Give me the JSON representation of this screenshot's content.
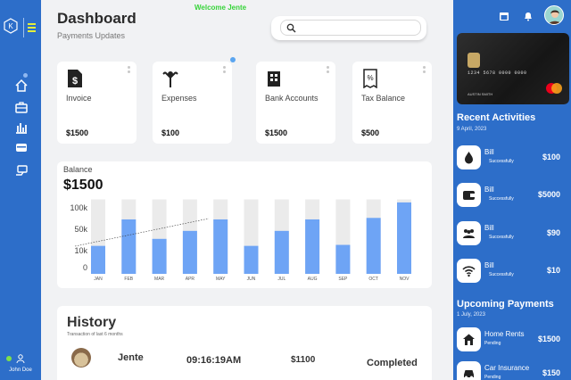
{
  "header": {
    "title": "Dashboard",
    "subtitle": "Payments Updates",
    "welcome": "Welcome Jente"
  },
  "search": {
    "placeholder": ""
  },
  "sidebar": {
    "items": [
      {
        "icon": "home-icon"
      },
      {
        "icon": "briefcase-icon"
      },
      {
        "icon": "bar-chart-icon"
      },
      {
        "icon": "wallet-icon"
      },
      {
        "icon": "payment-icon"
      }
    ],
    "user_name": "John Doe"
  },
  "cards": [
    {
      "label": "Invoice",
      "value": "$1500",
      "icon": "invoice-dollar-icon"
    },
    {
      "label": "Expenses",
      "value": "$100",
      "icon": "expenses-icon"
    },
    {
      "label": "Bank Accounts",
      "value": "$1500",
      "icon": "bank-building-icon"
    },
    {
      "label": "Tax Balance",
      "value": "$500",
      "icon": "tax-receipt-icon"
    }
  ],
  "balance": {
    "label": "Balance",
    "value": "$1500"
  },
  "chart_data": {
    "type": "bar",
    "categories": [
      "JAN",
      "FEB",
      "MAR",
      "APR",
      "MAY",
      "JUN",
      "JUL",
      "AUG",
      "SEP",
      "OCT",
      "NOV"
    ],
    "values": [
      5.6,
      10.9,
      7.0,
      8.6,
      10.9,
      5.6,
      8.6,
      10.9,
      5.8,
      11.2,
      14.3
    ],
    "capacity": [
      14.9,
      14.9,
      14.9,
      14.9,
      14.9,
      14.9,
      14.9,
      14.9,
      14.9,
      14.9,
      14.9
    ],
    "yticks": [
      "100k",
      "50k",
      "10k",
      "0"
    ],
    "ylim": [
      0,
      15
    ],
    "colors": {
      "bar": "#6ea4f5",
      "track": "#ebebeb"
    },
    "title": "",
    "xlabel": "",
    "ylabel": ""
  },
  "history": {
    "title": "History",
    "subtitle": "Transaction of last 6 months",
    "rows": [
      {
        "name": "Jente",
        "time": "09:16:19AM",
        "amount": "$1100",
        "status": "Completed"
      }
    ]
  },
  "right": {
    "card": {
      "number": "1234 5678 0000 0000",
      "holder": "AUSTIN SMITH",
      "brand": "mastercard"
    },
    "recent_title": "Recent Activities",
    "recent_date": "9 April, 2023",
    "activities": [
      {
        "title": "Bill",
        "sub": "Successfully",
        "amount": "$100",
        "icon": "water-drop-icon"
      },
      {
        "title": "Bill",
        "sub": "Successfully",
        "amount": "$5000",
        "icon": "wallet-icon"
      },
      {
        "title": "Bill",
        "sub": "Successfully",
        "amount": "$90",
        "icon": "people-icon"
      },
      {
        "title": "Bill",
        "sub": "Successfully",
        "amount": "$10",
        "icon": "wifi-icon"
      }
    ],
    "upcoming_title": "Upcoming Payments",
    "upcoming_date": "1 July, 2023",
    "payments": [
      {
        "title": "Home Rents",
        "sub": "Pending",
        "amount": "$1500",
        "icon": "home-icon"
      },
      {
        "title": "Car Insurance",
        "sub": "Pending",
        "amount": "$150",
        "icon": "car-icon"
      }
    ]
  },
  "colors": {
    "primary": "#2d6ec9",
    "accent_green": "#37d43a",
    "bar": "#6ea4f5"
  }
}
